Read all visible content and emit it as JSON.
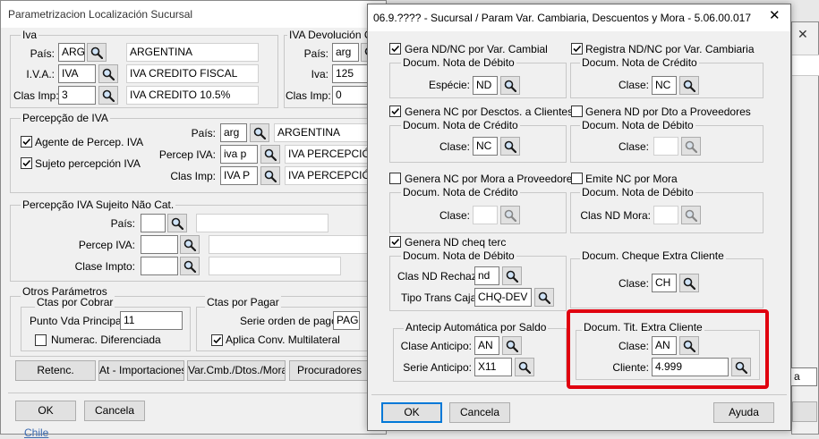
{
  "bg_window": {
    "title": "Parametrizacion Localización Sucursal",
    "iva": {
      "group_label": "Iva",
      "pais_label": "País:",
      "pais_code": "ARG",
      "pais_name": "ARGENTINA",
      "iva_label": "I.V.A.:",
      "iva_code": "IVA",
      "iva_name": "IVA   CREDITO FISCAL",
      "clas_label": "Clas Imp:",
      "clas_code": "3",
      "clas_name": "IVA CREDITO 10.5%"
    },
    "iva_dev": {
      "group_label": "IVA Devolución Ch",
      "pais_label": "País:",
      "pais_code": "arg",
      "iva_label": "Iva:",
      "iva_code": "125",
      "clas_label": "Clas Imp:",
      "clas_code": "0"
    },
    "percep_iva": {
      "group_label": "Percepção de IVA",
      "agente_label": "Agente de Percep. IVA",
      "sujeto_label": "Sujeto percepción IVA",
      "pais_label": "País:",
      "pais_code": "arg",
      "pais_name": "ARGENTINA",
      "percep_label": "Percep IVA:",
      "percep_code": "iva p",
      "percep_name": "IVA PERCEPCIÓ",
      "clas_label": "Clas Imp:",
      "clas_code": "IVA P",
      "clas_name": "IVA PERCEPCIÓ"
    },
    "percep_nocat": {
      "group_label": "Percepção IVA Sujeito Não Cat.",
      "pais_label": "País:",
      "percep_label": "Percep IVA:",
      "clase_label": "Clase Impto:"
    },
    "otros": {
      "group_label": "Otros Parámetros",
      "cobrar_label": "Ctas por Cobrar",
      "punto_label": "Punto Vda Principal:",
      "punto_value": "11",
      "numerac_label": "Numerac. Diferenciada",
      "pagar_label": "Ctas por Pagar",
      "serie_label": "Serie orden de pago:",
      "serie_value": "PAG",
      "aplica_label": "Aplica Conv. Multilateral"
    },
    "buttons": [
      "Retenc.",
      "At - Importaciones",
      "Var.Cmb./Dtos./Mora",
      "Procuradores"
    ],
    "ok_label": "OK",
    "cancel_label": "Cancela",
    "behind_text": "Chile"
  },
  "right_window": {
    "field_text": "a"
  },
  "dialog": {
    "title": "06.9.???? - Sucursal / Param Var. Cambiaria, Descuentos y Mora - 5.06.00.017",
    "close_glyph": "✕",
    "gera_cambial": {
      "check_label": "Gera ND/NC por Var. Cambial",
      "group_label": "Docum. Nota de Débito",
      "field_label": "Espécie:",
      "value": "ND"
    },
    "registra_cambiaria": {
      "check_label": "Registra ND/NC por Var. Cambiaria",
      "group_label": "Docum. Nota de Crédito",
      "field_label": "Clase:",
      "value": "NC"
    },
    "genera_desctos_clientes": {
      "check_label": "Genera NC por Desctos. a Clientes",
      "group_label": "Docum. Nota de Crédito",
      "field_label": "Clase:",
      "value": "NC"
    },
    "genera_dto_proveedores": {
      "check_label": "Genera ND por Dto a Proveedores",
      "group_label": "Docum. Nota de Débito",
      "field_label": "Clase:",
      "value": ""
    },
    "genera_mora_proveedores": {
      "check_label": "Genera NC por Mora a Proveedores",
      "group_label": "Docum. Nota de Crédito",
      "field_label": "Clase:",
      "value": ""
    },
    "emite_mora": {
      "check_label": "Emite NC por Mora",
      "group_label": "Docum. Nota de Débito",
      "field_label": "Clas ND Mora:",
      "value": ""
    },
    "genera_cheq_terc": {
      "check_label": "Genera ND cheq terc",
      "group_label": "Docum. Nota de Débito",
      "clas_label": "Clas ND Rechaz:",
      "clas_value": "nd",
      "tipo_label": "Tipo Trans Caja:",
      "tipo_value": "CHQ-DEV"
    },
    "cheque_extra": {
      "group_label": "Docum. Cheque Extra Cliente",
      "field_label": "Clase:",
      "value": "CH"
    },
    "antecip": {
      "group_label": "Antecip Automática por Saldo",
      "clase_label": "Clase Anticipo:",
      "clase_value": "AN",
      "serie_label": "Serie  Anticipo:",
      "serie_value": "X11"
    },
    "tit_extra": {
      "group_label": "Docum. Tit. Extra Cliente",
      "clase_label": "Clase:",
      "clase_value": "AN",
      "cliente_label": "Cliente:",
      "cliente_value": "4.999"
    },
    "ok_label": "OK",
    "cancel_label": "Cancela",
    "help_label": "Ayuda"
  },
  "colors": {
    "highlight": "#e0000f",
    "focus": "#0078d7"
  }
}
